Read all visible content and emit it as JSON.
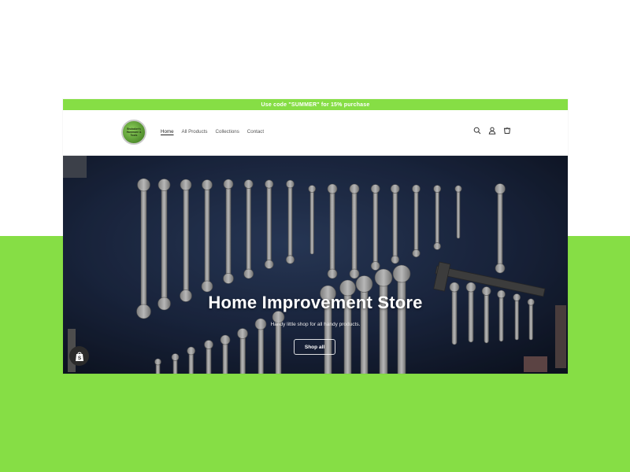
{
  "colors": {
    "brand_green": "#86de45",
    "announcement_green": "#86de45",
    "hero_blue": "#1b2740"
  },
  "announcement": {
    "text": "Use code \"SUMMER\" for 15% purchase"
  },
  "header": {
    "logo_text": "Brubaker's Hardware & Tools",
    "nav": [
      {
        "label": "Home",
        "active": true
      },
      {
        "label": "All Products",
        "active": false
      },
      {
        "label": "Collections",
        "active": false
      },
      {
        "label": "Contact",
        "active": false
      }
    ],
    "icons": [
      "search-icon",
      "account-icon",
      "cart-icon"
    ]
  },
  "hero": {
    "title": "Home Improvement Store",
    "subtitle": "Handy little shop for all handy products.",
    "button_label": "Shop all"
  },
  "badge": {
    "icon": "shopify-bag-icon",
    "letter": "S"
  }
}
